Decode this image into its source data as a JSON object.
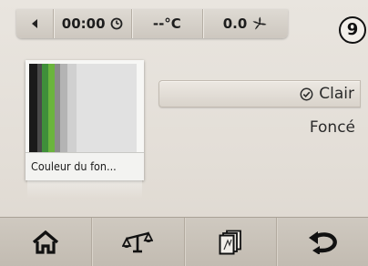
{
  "status_bar": {
    "time": "00:00",
    "temperature": "--°C",
    "fan_speed": "0.0",
    "back_icon": "back-arrow-icon",
    "clock_icon": "clock-icon",
    "fan_icon": "fan-icon"
  },
  "page_indicator": "9",
  "color_tile": {
    "label": "Couleur du fon...",
    "stripe_colors": [
      "#1a1a1a",
      "#4a4a4a",
      "#3f8f3a",
      "#6bb43c",
      "#8a8a8a",
      "#b4b4b4",
      "#d0d0d0",
      "#e1e1e1"
    ]
  },
  "options": [
    {
      "label": "Clair",
      "selected": true,
      "icon": "checkmark-circle-icon"
    },
    {
      "label": "Foncé",
      "selected": false
    }
  ],
  "nav": {
    "items": [
      {
        "name": "home",
        "icon": "home-icon"
      },
      {
        "name": "balance",
        "icon": "balance-scale-icon"
      },
      {
        "name": "pages",
        "icon": "pages-icon"
      },
      {
        "name": "return",
        "icon": "return-arrow-icon"
      }
    ]
  }
}
